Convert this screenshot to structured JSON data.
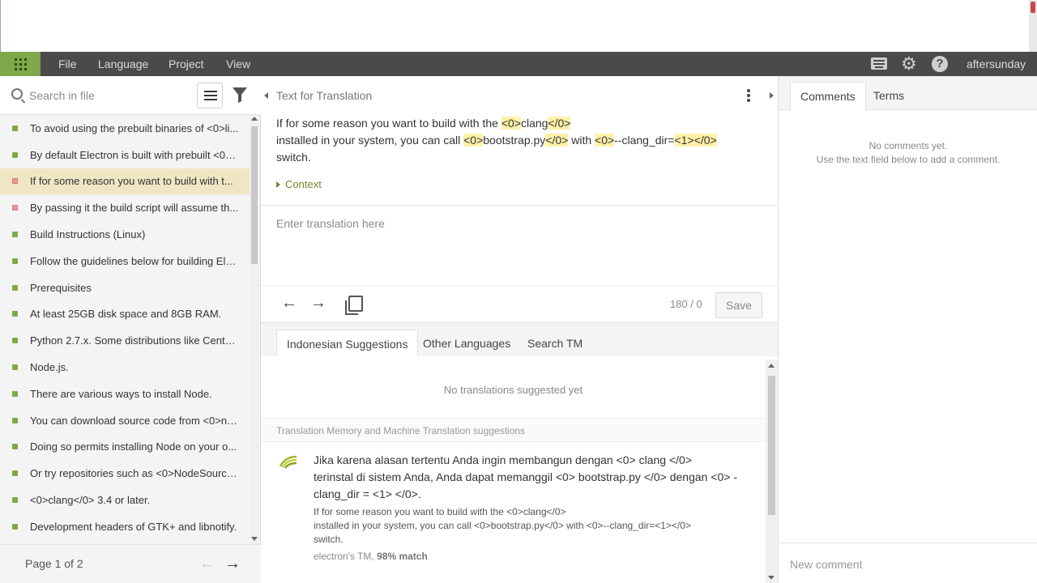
{
  "menubar": {
    "items": [
      "File",
      "Language",
      "Project",
      "View"
    ],
    "user": "aftersunday"
  },
  "search": {
    "placeholder": "Search in file"
  },
  "segments": [
    {
      "text": "To avoid using the prebuilt binaries of <0>li...",
      "status": "translated",
      "active": false
    },
    {
      "text": "By default Electron is built with prebuilt <0>...",
      "status": "translated",
      "active": false
    },
    {
      "text": "If for some reason you want to build with t...",
      "status": "untranslated",
      "active": true
    },
    {
      "text": "By passing it the build script will assume th...",
      "status": "untranslated",
      "active": false
    },
    {
      "text": "Build Instructions (Linux)",
      "status": "translated",
      "active": false
    },
    {
      "text": "Follow the guidelines below for building Ele...",
      "status": "translated",
      "active": false
    },
    {
      "text": "Prerequisites",
      "status": "translated",
      "active": false
    },
    {
      "text": "At least 25GB disk space and 8GB RAM.",
      "status": "translated",
      "active": false
    },
    {
      "text": "Python 2.7.x. Some distributions like CentO...",
      "status": "translated",
      "active": false
    },
    {
      "text": "Node.js.",
      "status": "translated",
      "active": false
    },
    {
      "text": "There are various ways to install Node.",
      "status": "translated",
      "active": false
    },
    {
      "text": "You can download source code from <0>no...",
      "status": "translated",
      "active": false
    },
    {
      "text": "Doing so permits installing Node on your o...",
      "status": "translated",
      "active": false
    },
    {
      "text": "Or try repositories such as <0>NodeSource...",
      "status": "translated",
      "active": false
    },
    {
      "text": "<0>clang</0> 3.4 or later.",
      "status": "translated",
      "active": false
    },
    {
      "text": "Development headers of GTK+ and libnotify.",
      "status": "translated",
      "active": false
    }
  ],
  "pager": {
    "label": "Page 1 of 2"
  },
  "source": {
    "title": "Text for Translation",
    "parts": [
      {
        "t": "If for some reason you want to build with the ",
        "tag": false
      },
      {
        "t": "<0>",
        "tag": true
      },
      {
        "t": "clang",
        "tag": false
      },
      {
        "t": "</0>",
        "tag": true
      },
      {
        "t": "\ninstalled in your system, you can call ",
        "tag": false
      },
      {
        "t": "<0>",
        "tag": true
      },
      {
        "t": "bootstrap.py",
        "tag": false
      },
      {
        "t": "</0>",
        "tag": true
      },
      {
        "t": " with ",
        "tag": false
      },
      {
        "t": "<0>",
        "tag": true
      },
      {
        "t": "--clang_dir=",
        "tag": false
      },
      {
        "t": "<1>",
        "tag": true
      },
      {
        "t": "</0>",
        "tag": true
      },
      {
        "t": "\nswitch.",
        "tag": false
      }
    ],
    "context_label": "Context"
  },
  "editor": {
    "placeholder": "Enter translation here",
    "counter": "180 / 0",
    "save_label": "Save"
  },
  "suggestion_tabs": [
    "Indonesian Suggestions",
    "Other Languages",
    "Search TM"
  ],
  "suggestions": {
    "empty_text": "No translations suggested yet",
    "tm_header": "Translation Memory and Machine Translation suggestions",
    "tm_item": {
      "target": "Jika karena alasan tertentu Anda ingin membangun dengan <0> clang </0>\nterinstal di sistem Anda, Anda dapat memanggil <0> bootstrap.py </0> dengan <0> -clang_dir = <1> </0>.",
      "source": "If for some reason you want to build with the <0>clang</0>\ninstalled in your system, you can call <0>bootstrap.py</0> with <0>--clang_dir=<1></0>\nswitch.",
      "meta_source": "electron's TM, ",
      "meta_match": "98% match"
    }
  },
  "right_tabs": [
    "Comments",
    "Terms"
  ],
  "comments": {
    "empty_line1": "No comments yet.",
    "empty_line2": "Use the text field below to add a comment.",
    "placeholder": "New comment"
  },
  "colors": {
    "accent_green": "#7fa84a",
    "menubar_bg": "#4a4a4a",
    "active_row": "#efe6c4",
    "tag_highlight": "#fff1a8"
  }
}
